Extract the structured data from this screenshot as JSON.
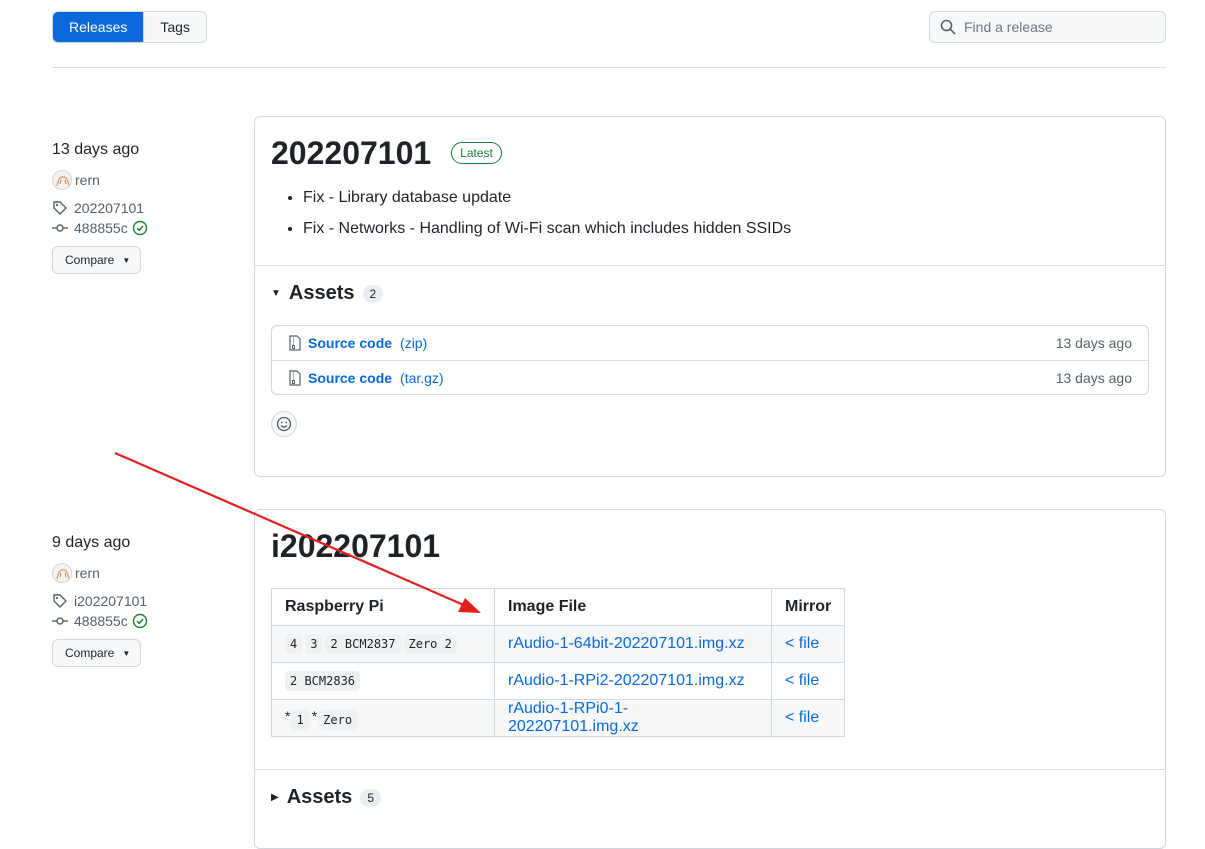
{
  "toolbar": {
    "tab_releases": "Releases",
    "tab_tags": "Tags",
    "search_placeholder": "Find a release"
  },
  "colors": {
    "accent": "#0969da",
    "success": "#1a7f37",
    "annotation_arrow": "#e02020"
  },
  "releases": [
    {
      "date": "13 days ago",
      "author": "rern",
      "tag": "202207101",
      "commit": "488855c",
      "compare_label": "Compare",
      "title": "202207101",
      "badge": "Latest",
      "notes": [
        "Fix - Library database update",
        "Fix - Networks - Handling of Wi-Fi scan which includes hidden SSIDs"
      ],
      "assets_label": "Assets",
      "assets_count": "2",
      "assets": [
        {
          "name": "Source code",
          "format": "(zip)",
          "when": "13 days ago"
        },
        {
          "name": "Source code",
          "format": "(tar.gz)",
          "when": "13 days ago"
        }
      ]
    },
    {
      "date": "9 days ago",
      "author": "rern",
      "tag": "i202207101",
      "commit": "488855c",
      "compare_label": "Compare",
      "title": "i202207101",
      "table": {
        "headers": [
          "Raspberry Pi",
          "Image File",
          "Mirror"
        ],
        "rows": [
          {
            "models": [
              "4",
              "3",
              "2 BCM2837",
              "Zero 2"
            ],
            "file": "rAudio-1-64bit-202207101.img.xz",
            "mirror": "< file"
          },
          {
            "models": [
              "2 BCM2836"
            ],
            "file": "rAudio-1-RPi2-202207101.img.xz",
            "mirror": "< file"
          },
          {
            "models": [
              "1",
              "Zero"
            ],
            "file": "rAudio-1-RPi0-1-202207101.img.xz",
            "mirror": "< file"
          }
        ],
        "star": "*"
      },
      "assets_label": "Assets",
      "assets_count": "5"
    }
  ]
}
